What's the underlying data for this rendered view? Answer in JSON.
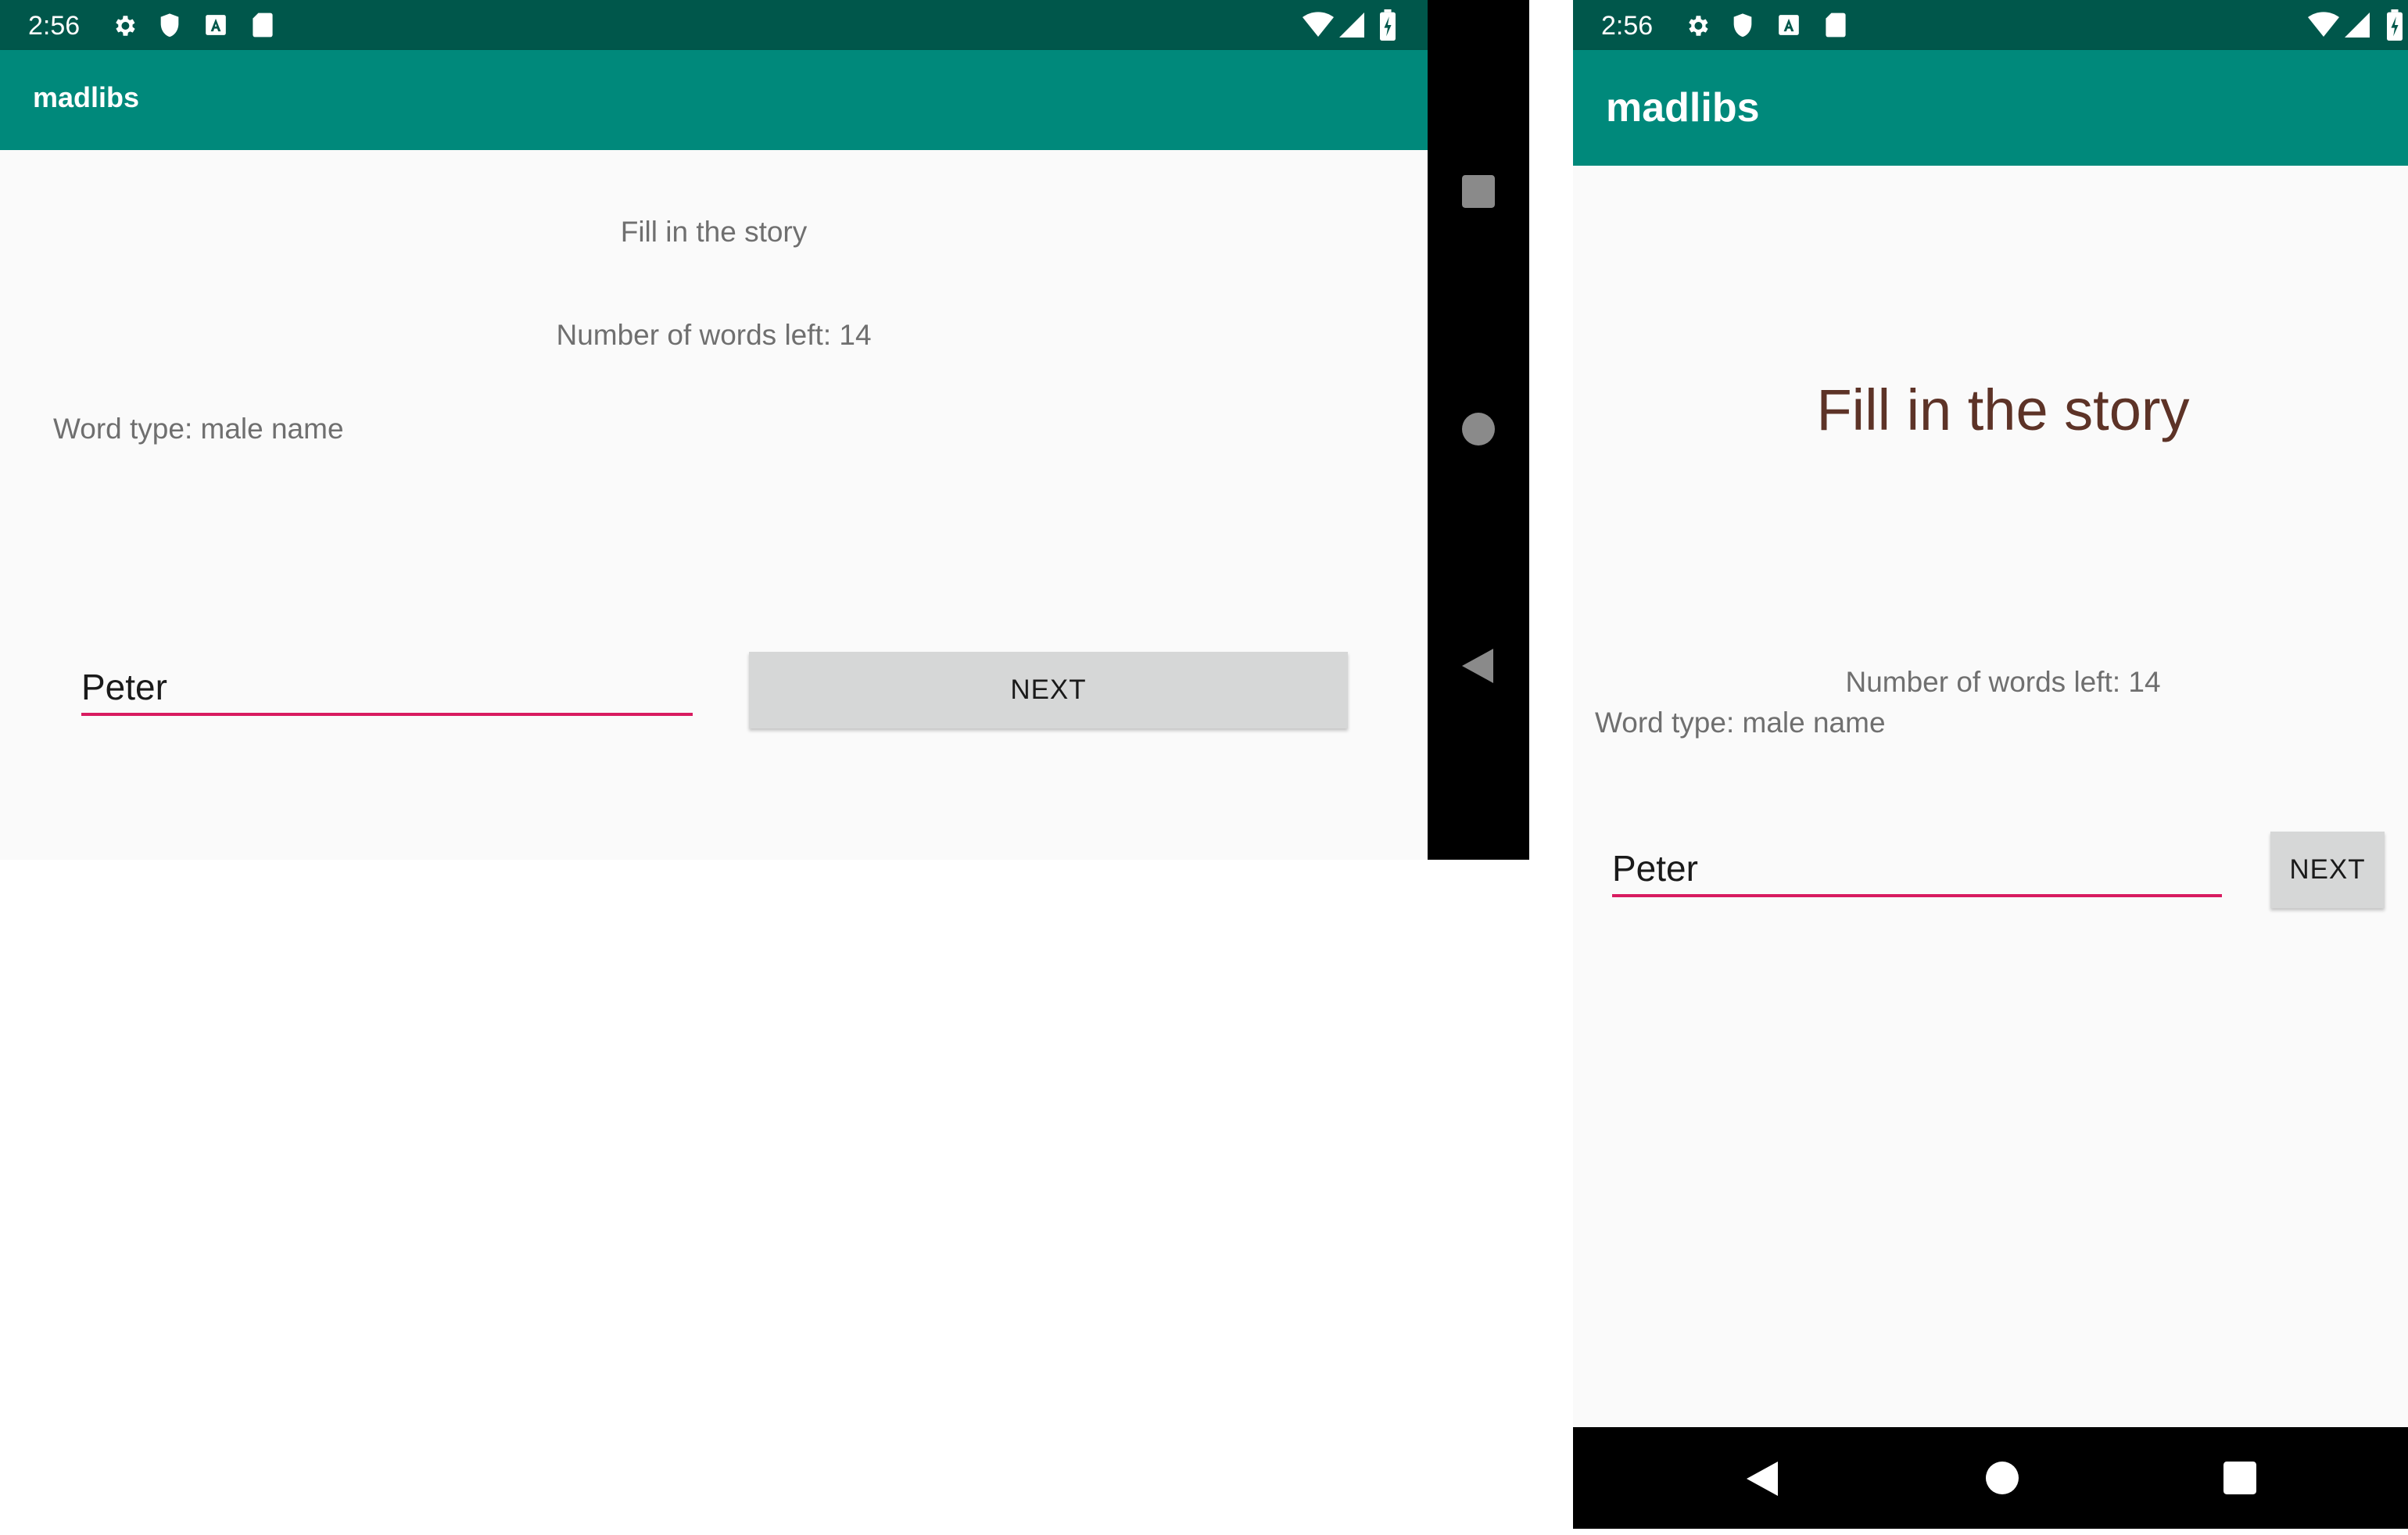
{
  "landscape": {
    "status": {
      "time": "2:56"
    },
    "appbar": {
      "title": "madlibs"
    },
    "heading": "Fill in the story",
    "words_left": "Number of words left: 14",
    "word_type": "Word type: male name",
    "input": {
      "value": "Peter"
    },
    "next_label": "NEXT",
    "nav_icons": [
      "recents-icon",
      "home-icon",
      "back-icon"
    ]
  },
  "portrait": {
    "status": {
      "time": "2:56"
    },
    "appbar": {
      "title": "madlibs"
    },
    "heading": "Fill in the story",
    "words_left": "Number of words left: 14",
    "word_type": "Word type: male name",
    "input": {
      "value": "Peter"
    },
    "next_label": "NEXT",
    "nav_icons": [
      "back-icon",
      "home-icon",
      "recents-icon"
    ]
  },
  "colors": {
    "status_bar": "#00574b",
    "app_bar": "#00897b",
    "accent": "#d81b60",
    "heading_portrait": "#5d3327",
    "background": "#fafafa",
    "nav_bar": "#000000"
  }
}
